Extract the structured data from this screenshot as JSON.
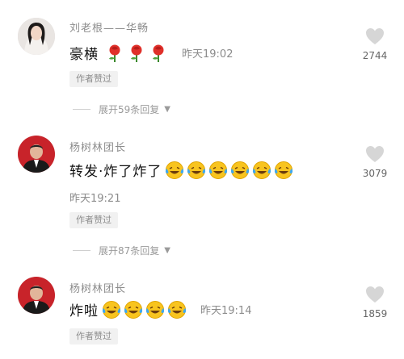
{
  "comments": [
    {
      "username": "刘老根——华畅",
      "text": "豪横",
      "emoji_icon": "rose-icon",
      "emoji_count": 3,
      "time": "昨天19:02",
      "badge": "作者赞过",
      "likes": "2744"
    },
    {
      "username": "杨树林团长",
      "text": "转发·炸了炸了",
      "emoji_icon": "laughing-tears-icon",
      "emoji_count": 6,
      "time": "昨天19:21",
      "badge": "作者赞过",
      "likes": "3079"
    },
    {
      "username": "杨树林团长",
      "text": "炸啦",
      "emoji_icon": "laughing-tears-icon",
      "emoji_count": 4,
      "time": "昨天19:14",
      "badge": "作者赞过",
      "likes": "1859"
    }
  ],
  "expand_replies": [
    {
      "label": "展开59条回复"
    },
    {
      "label": "展开87条回复"
    }
  ],
  "colors": {
    "muted_text": "#8c8c8c",
    "badge_bg": "#f1f1f1",
    "heart": "#d6d6d6"
  }
}
